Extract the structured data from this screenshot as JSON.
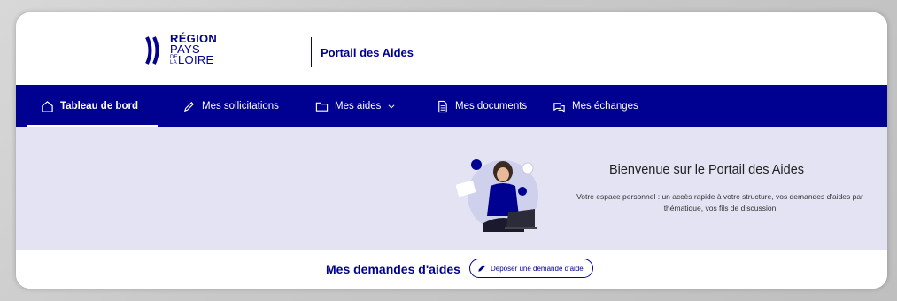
{
  "header": {
    "logo_lines": [
      "RÉGION",
      "PAYS",
      "DE LA",
      "LOIRE"
    ],
    "portal_title": "Portail des Aides"
  },
  "nav": {
    "items": [
      {
        "label": "Tableau de bord",
        "icon": "home-icon",
        "active": true
      },
      {
        "label": "Mes sollicitations",
        "icon": "pencil-icon",
        "active": false
      },
      {
        "label": "Mes aides",
        "icon": "folder-icon",
        "active": false,
        "has_dropdown": true
      },
      {
        "label": "Mes documents",
        "icon": "document-icon",
        "active": false
      },
      {
        "label": "Mes échanges",
        "icon": "chat-icon",
        "active": false
      }
    ]
  },
  "hero": {
    "title": "Bienvenue sur le Portail des Aides",
    "description": "Votre espace personnel : un accès rapide à votre structure, vos demandes d'aides par thématique, vos fils de discussion"
  },
  "demandes": {
    "title": "Mes demandes d'aides",
    "button_label": "Déposer une demande d'aide"
  },
  "colors": {
    "primary": "#000091",
    "hero_bg": "#e3e3f3",
    "white": "#ffffff"
  }
}
